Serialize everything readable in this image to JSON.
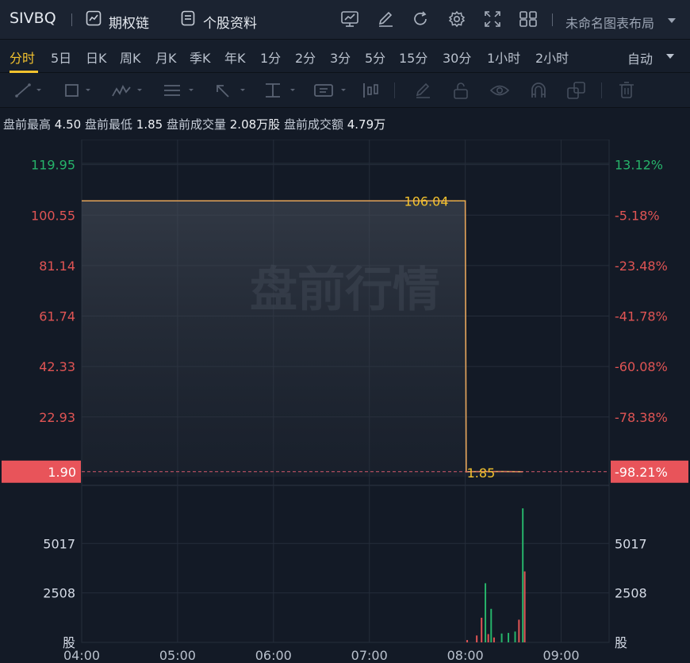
{
  "header": {
    "ticker": "SIVBQ",
    "options_chain": "期权链",
    "stock_profile": "个股资料",
    "layout_name": "未命名图表布局"
  },
  "periods": {
    "items": [
      "分时",
      "5日",
      "日K",
      "周K",
      "月K",
      "季K",
      "年K",
      "1分",
      "2分",
      "3分",
      "5分",
      "15分",
      "30分",
      "1小时",
      "2小时"
    ],
    "active": "分时",
    "auto_label": "自动"
  },
  "stats": {
    "high_label": "盘前最高",
    "high": "4.50",
    "low_label": "盘前最低",
    "low": "1.85",
    "vol_label": "盘前成交量",
    "vol": "2.08万股",
    "amt_label": "盘前成交额",
    "amt": "4.79万"
  },
  "colors": {
    "accent": "#f3c22e",
    "up": "#26b36a",
    "down": "#e05454",
    "price_line": "#e6a55a",
    "tag_bg": "#e8545a"
  },
  "chart_data": {
    "type": "line",
    "watermark": "盘前行情",
    "x_ticks": [
      "04:00",
      "05:00",
      "06:00",
      "07:00",
      "08:00",
      "09:00"
    ],
    "x_range_hours": [
      4,
      9.5
    ],
    "price_ticks": [
      "119.95",
      "100.55",
      "81.14",
      "61.74",
      "42.33",
      "22.93",
      "1.90"
    ],
    "pct_ticks": [
      "13.12%",
      "-5.18%",
      "-23.48%",
      "-41.78%",
      "-60.08%",
      "-78.38%",
      "-98.21%"
    ],
    "ylim": [
      0,
      129.6
    ],
    "reference_price": 1.9,
    "current_price": "1.90",
    "current_pct": "-98.21%",
    "max_label": "106.04",
    "min_label": "1.85",
    "series": [
      {
        "x": [
          4.0,
          8.0,
          8.01,
          8.05,
          8.4,
          8.6
        ],
        "y": [
          106.04,
          106.04,
          1.85,
          1.92,
          1.95,
          1.88
        ]
      }
    ],
    "volume": {
      "ticks": [
        "5017",
        "2508"
      ],
      "unit": "股",
      "ylim": [
        0,
        7000
      ],
      "bars": [
        {
          "x": 8.02,
          "v": 120,
          "up": false
        },
        {
          "x": 8.12,
          "v": 350,
          "up": false
        },
        {
          "x": 8.17,
          "v": 1250,
          "up": false
        },
        {
          "x": 8.21,
          "v": 3000,
          "up": true
        },
        {
          "x": 8.24,
          "v": 420,
          "up": false
        },
        {
          "x": 8.27,
          "v": 1700,
          "up": true
        },
        {
          "x": 8.3,
          "v": 250,
          "up": false
        },
        {
          "x": 8.38,
          "v": 450,
          "up": true
        },
        {
          "x": 8.45,
          "v": 480,
          "up": true
        },
        {
          "x": 8.52,
          "v": 550,
          "up": true
        },
        {
          "x": 8.56,
          "v": 1150,
          "up": false
        },
        {
          "x": 8.6,
          "v": 6800,
          "up": true
        },
        {
          "x": 8.62,
          "v": 3600,
          "up": false
        }
      ]
    }
  }
}
